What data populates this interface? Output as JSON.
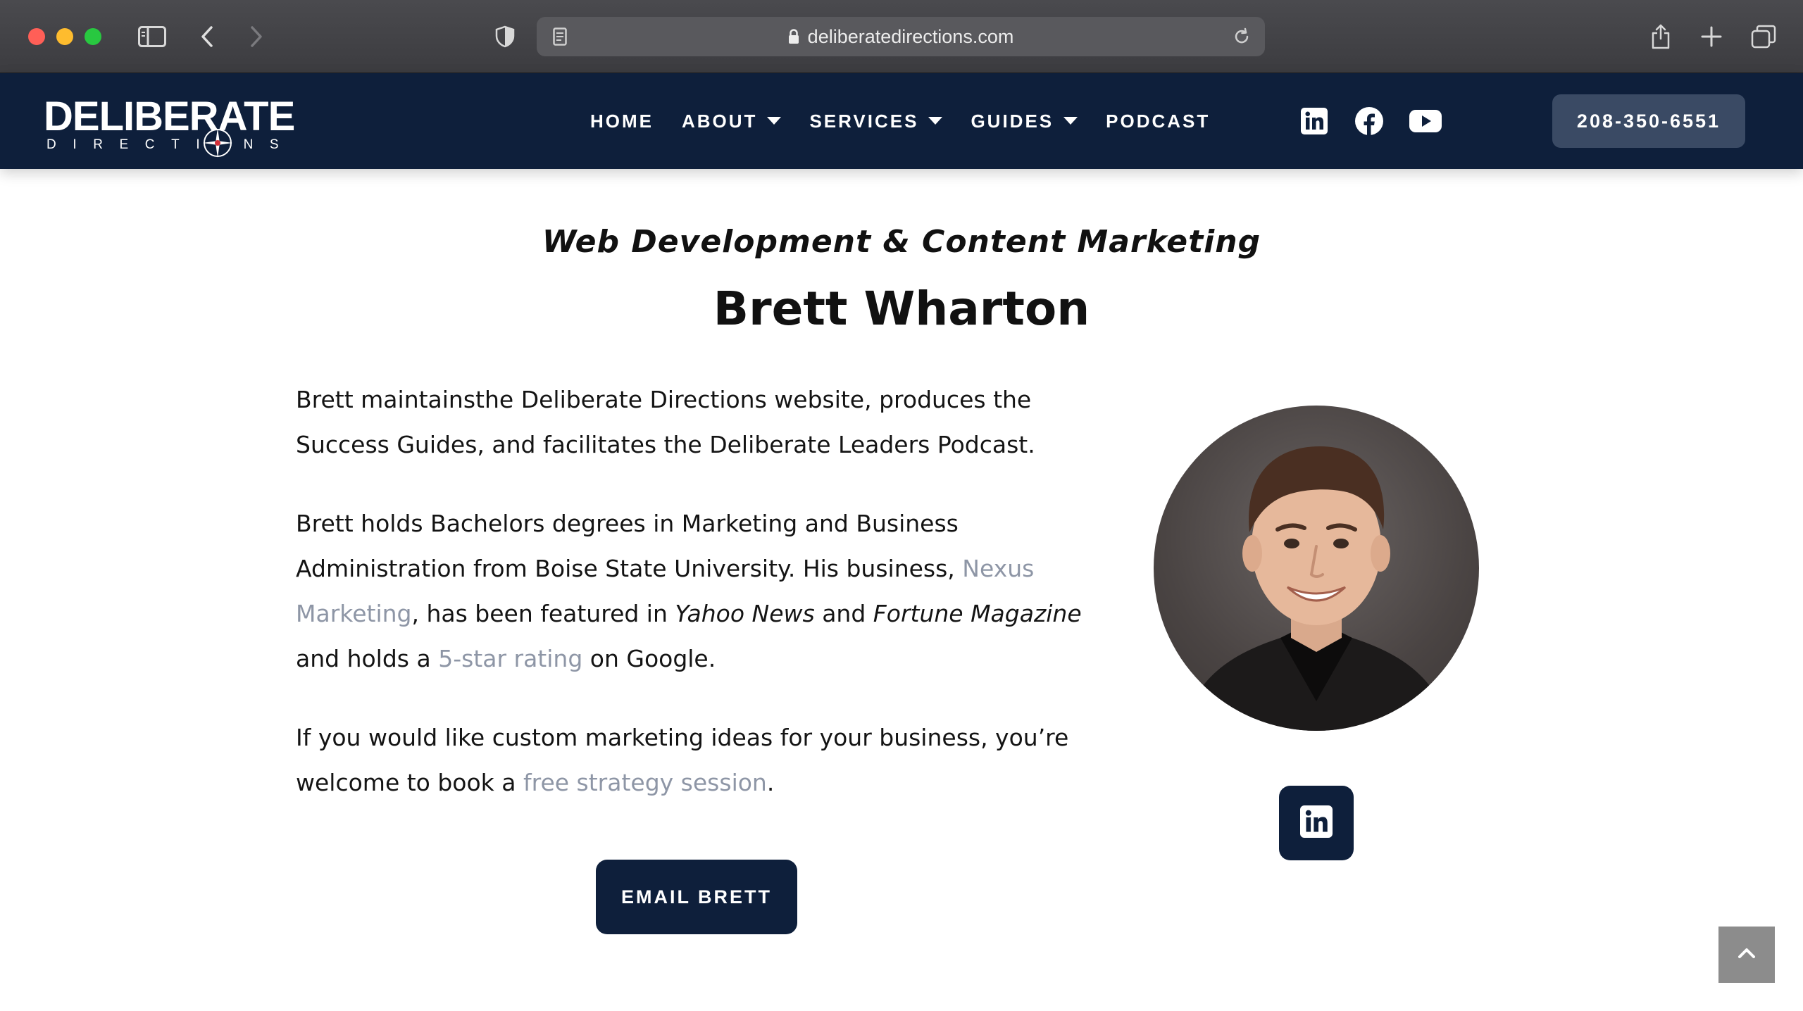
{
  "browser": {
    "url": "deliberatedirections.com"
  },
  "site": {
    "logo_main": "DELIBERATE",
    "logo_sub": "DIRECTIONS",
    "nav": [
      {
        "label": "HOME",
        "has_dropdown": false
      },
      {
        "label": "ABOUT",
        "has_dropdown": true
      },
      {
        "label": "SERVICES",
        "has_dropdown": true
      },
      {
        "label": "GUIDES",
        "has_dropdown": true
      },
      {
        "label": "PODCAST",
        "has_dropdown": false
      }
    ],
    "social_icons": [
      "linkedin-icon",
      "facebook-icon",
      "youtube-icon"
    ],
    "phone": "208-350-6551"
  },
  "profile": {
    "subtitle": "Web Development & Content Marketing",
    "name": "Brett Wharton",
    "p1": "Brett maintainsthe Deliberate Directions website, produces the Success Guides, and facilitates the Deliberate Leaders Podcast.",
    "p2_a": "Brett holds Bachelors degrees in Marketing and Business Administration from Boise State University. His business, ",
    "p2_link1": "Nexus Marketing",
    "p2_b": ", has been featured in ",
    "p2_em1": "Yahoo News",
    "p2_c": " and ",
    "p2_em2": "Fortune Magazine",
    "p2_d": " and holds a ",
    "p2_link2": "5-star rating",
    "p2_e": " on Google.",
    "p3_a": "If you would like custom marketing ideas for your business, you’re welcome to book a ",
    "p3_link": "free strategy session",
    "p3_b": ".",
    "email_button": "EMAIL BRETT"
  },
  "colors": {
    "navy": "#0e1f3b",
    "link": "#8e96a6",
    "phone_button": "#3a4a64"
  }
}
